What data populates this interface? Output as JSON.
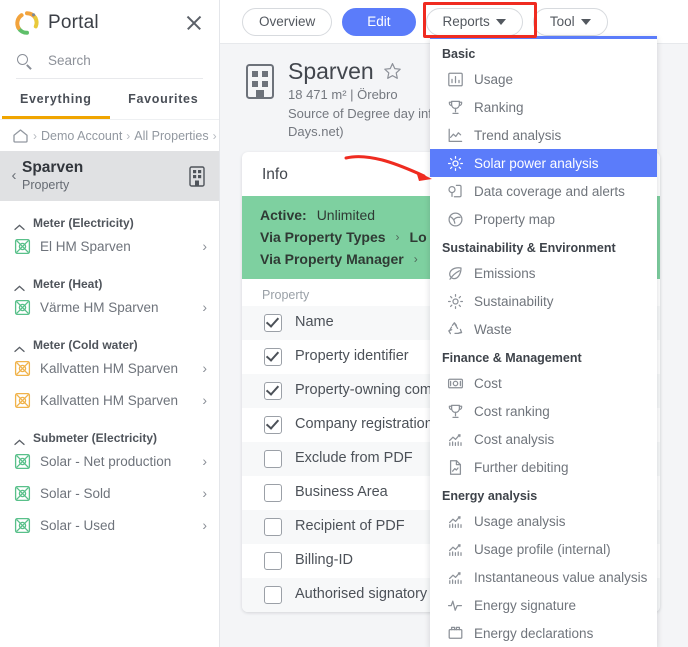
{
  "sidebar": {
    "brand": "Portal",
    "logo_icon": "portal-ring-logo",
    "close_icon": "close-icon",
    "search": {
      "placeholder": "Search",
      "value": "",
      "icon": "search-icon"
    },
    "tabs": [
      {
        "label": "Everything",
        "active": true
      },
      {
        "label": "Favourites",
        "active": false
      }
    ],
    "breadcrumb": {
      "home_icon": "home-icon",
      "items": [
        "Demo Account",
        "All Properties"
      ],
      "separator": "›",
      "trailing_separator": "›"
    },
    "selected_property": {
      "back_icon": "chevron-left-icon",
      "name": "Sparven",
      "subtitle": "Property",
      "type_icon": "building-icon"
    },
    "groups": [
      {
        "label": "Meter (Electricity)",
        "collapse_icon": "caret-up-icon",
        "items": [
          {
            "label": "El HM Sparven",
            "icon": "meter-icon",
            "icon_color": "#59c08a",
            "chevron": "›"
          }
        ]
      },
      {
        "label": "Meter (Heat)",
        "collapse_icon": "caret-up-icon",
        "items": [
          {
            "label": "Värme HM Sparven",
            "icon": "meter-icon",
            "icon_color": "#59c08a",
            "chevron": "›"
          }
        ]
      },
      {
        "label": "Meter (Cold water)",
        "collapse_icon": "caret-up-icon",
        "items": [
          {
            "label": "Kallvatten HM Sparven",
            "icon": "meter-icon",
            "icon_color": "#f0b34b",
            "chevron": "›"
          },
          {
            "label": "Kallvatten HM Sparven",
            "icon": "meter-icon",
            "icon_color": "#f0b34b",
            "chevron": "›"
          }
        ]
      },
      {
        "label": "Submeter (Electricity)",
        "collapse_icon": "caret-up-icon",
        "items": [
          {
            "label": "Solar - Net production",
            "icon": "meter-icon",
            "icon_color": "#59c08a",
            "chevron": "›"
          },
          {
            "label": "Solar - Sold",
            "icon": "meter-icon",
            "icon_color": "#59c08a",
            "chevron": "›"
          },
          {
            "label": "Solar - Used",
            "icon": "meter-icon",
            "icon_color": "#59c08a",
            "chevron": "›"
          }
        ]
      }
    ]
  },
  "toolbar": {
    "overview_label": "Overview",
    "edit_label": "Edit",
    "reports_label": "Reports",
    "tool_label": "Tool",
    "dropdown_icon": "chevron-down-icon",
    "primary_color": "#5b7cfa"
  },
  "page": {
    "icon": "building-icon",
    "title": "Sparven",
    "favourite_icon": "star-icon",
    "meta_line1": "18 471 m² | Örebro",
    "meta_line2": "Source of Degree day inf",
    "meta_line3": "Days.net)"
  },
  "info_card": {
    "title": "Info",
    "status": {
      "label": "Active:",
      "value": "Unlimited"
    },
    "links": [
      {
        "label": "Via Property Types",
        "chevron": "›",
        "trailing": "Lo"
      },
      {
        "label": "Via Property Manager",
        "chevron": "›",
        "trailing": ""
      }
    ],
    "section_label": "Property",
    "fields": [
      {
        "label": "Name",
        "checked": true
      },
      {
        "label": "Property identifier",
        "checked": true
      },
      {
        "label": "Property-owning companies",
        "checked": true
      },
      {
        "label": "Company registration number",
        "checked": true
      },
      {
        "label": "Exclude from PDF",
        "checked": false
      },
      {
        "label": "Business Area",
        "checked": false
      },
      {
        "label": "Recipient of PDF",
        "checked": false
      },
      {
        "label": "Billing-ID",
        "checked": false
      },
      {
        "label": "Authorised signatory",
        "checked": false
      }
    ]
  },
  "reports_menu": {
    "highlight_color": "#5b7cfa",
    "sections": [
      {
        "label": "Basic",
        "items": [
          {
            "label": "Usage",
            "icon": "bar-chart-icon",
            "selected": false
          },
          {
            "label": "Ranking",
            "icon": "trophy-icon",
            "selected": false
          },
          {
            "label": "Trend analysis",
            "icon": "line-chart-icon",
            "selected": false
          },
          {
            "label": "Solar power analysis",
            "icon": "gear-icon",
            "selected": true
          },
          {
            "label": "Data coverage and alerts",
            "icon": "alert-doc-icon",
            "selected": false
          },
          {
            "label": "Property map",
            "icon": "globe-icon",
            "selected": false
          }
        ]
      },
      {
        "label": "Sustainability & Environment",
        "items": [
          {
            "label": "Emissions",
            "icon": "leaf-icon",
            "selected": false
          },
          {
            "label": "Sustainability",
            "icon": "gear-icon",
            "selected": false
          },
          {
            "label": "Waste",
            "icon": "recycle-icon",
            "selected": false
          }
        ]
      },
      {
        "label": "Finance & Management",
        "items": [
          {
            "label": "Cost",
            "icon": "banknote-icon",
            "selected": false
          },
          {
            "label": "Cost ranking",
            "icon": "trophy-icon",
            "selected": false
          },
          {
            "label": "Cost analysis",
            "icon": "analytics-icon",
            "selected": false
          },
          {
            "label": "Further debiting",
            "icon": "document-icon",
            "selected": false
          }
        ]
      },
      {
        "label": "Energy analysis",
        "items": [
          {
            "label": "Usage analysis",
            "icon": "analytics-icon",
            "selected": false
          },
          {
            "label": "Usage profile (internal)",
            "icon": "analytics-icon",
            "selected": false
          },
          {
            "label": "Instantaneous value analysis",
            "icon": "analytics-icon",
            "selected": false
          },
          {
            "label": "Energy signature",
            "icon": "pulse-icon",
            "selected": false
          },
          {
            "label": "Energy declarations",
            "icon": "certificate-icon",
            "selected": false
          }
        ]
      }
    ]
  },
  "annotations": {
    "highlight_box_target": "Reports",
    "highlight_box_color": "#ef2b20",
    "arrow_color": "#ef2b20",
    "arrow_target": "Solar power analysis"
  }
}
